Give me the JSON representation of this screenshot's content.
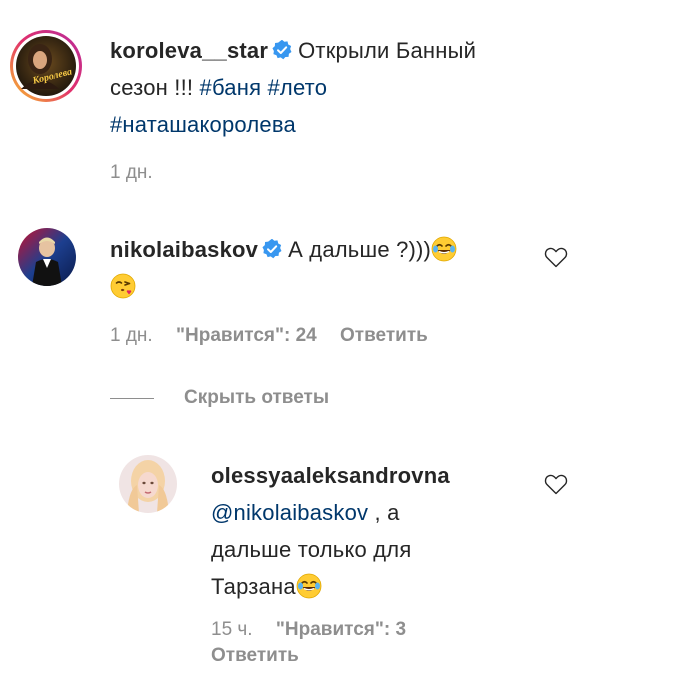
{
  "post": {
    "username": "koroleva__star",
    "caption_text": "Открыли Банный сезон !!!",
    "hashtags": [
      "#баня",
      "#лето",
      "#наташакоролева"
    ],
    "time": "1 дн.",
    "avatar_text": "Королева"
  },
  "comments": [
    {
      "username": "nikolaibaskov",
      "text": "А дальше ?)))",
      "emoji": [
        "face-with-tears-of-joy",
        "face-blowing-kiss"
      ],
      "time": "1 дн.",
      "likes_label": "\"Нравится\": 24",
      "reply_label": "Ответить"
    }
  ],
  "hide_replies_label": "Скрыть ответы",
  "replies": [
    {
      "username": "olessyaaleksandrovna",
      "mention": "@nikolaibaskov",
      "text_part1": ", а",
      "text_part2": "дальше только для",
      "text_part3": "Тарзана",
      "emoji": [
        "face-with-tears-of-joy"
      ],
      "time": "15 ч.",
      "likes_label": "\"Нравится\": 3",
      "reply_label": "Ответить"
    }
  ],
  "colors": {
    "text": "#262626",
    "link": "#00376b",
    "meta": "#8e8e8e",
    "verified": "#3897f0",
    "avatar_ring": "#e1306c"
  }
}
